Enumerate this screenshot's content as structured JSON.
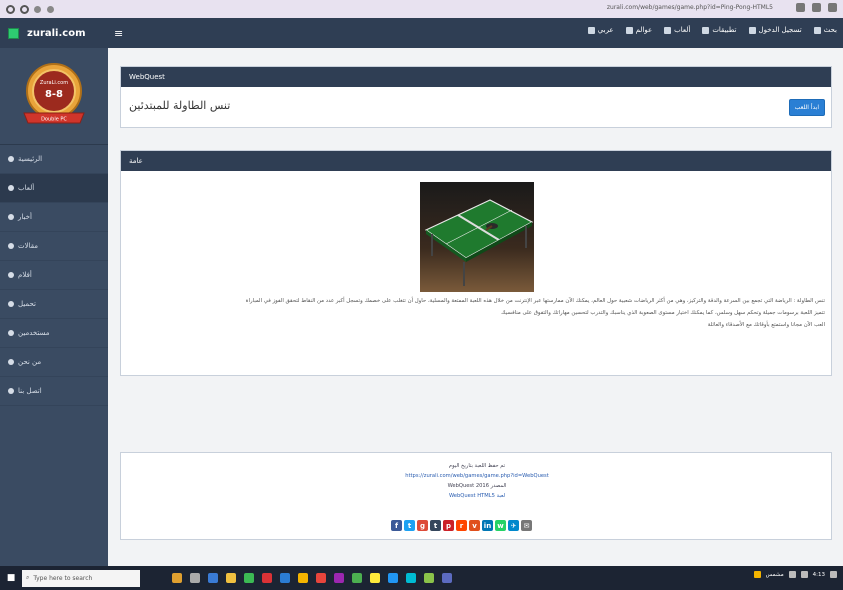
{
  "browser": {
    "url": "zurali.com/web/games/game.php?id=Ping-Pong-HTML5",
    "icons": [
      "reload-icon",
      "tab-icon",
      "back-icon",
      "forward-icon"
    ]
  },
  "navbar": {
    "brand": "zurali.com",
    "menu_icon": "≡",
    "links": [
      {
        "label": "عربي",
        "icon": "globe-icon"
      },
      {
        "label": "عوالم",
        "icon": "grid-icon"
      },
      {
        "label": "ألعاب",
        "icon": "gamepad-icon"
      },
      {
        "label": "تطبيقات",
        "icon": "apps-icon"
      },
      {
        "label": "تسجيل الدخول",
        "icon": "user-icon"
      },
      {
        "label": "بحث",
        "icon": "search-icon"
      }
    ]
  },
  "badge": {
    "line1": "ZuraLi.com",
    "score": "8-8",
    "ribbon": "Double PC"
  },
  "sidebar": {
    "items": [
      {
        "label": "الرئيسية",
        "active": false
      },
      {
        "label": "ألعاب",
        "active": true
      },
      {
        "label": "أخبار",
        "active": false
      },
      {
        "label": "مقالات",
        "active": false
      },
      {
        "label": "أفلام",
        "active": false
      },
      {
        "label": "تحميل",
        "active": false
      },
      {
        "label": "مستخدمين",
        "active": false
      },
      {
        "label": "من نحن",
        "active": false
      },
      {
        "label": "اتصل بنا",
        "active": false
      }
    ]
  },
  "title_panel": {
    "header": "WebQuest",
    "title": "تنس الطاولة للمبتدئين",
    "button": "ابدأ اللعب"
  },
  "content_panel": {
    "header": "عامة",
    "description": [
      "تنس الطاولة : الرياضة التي تجمع بين السرعة والدقة والتركيز، وهي من أكثر الرياضات شعبية حول العالم، يمكنك الآن ممارستها عبر الإنترنت من خلال هذه اللعبة الممتعة والمسلية، حاول أن تتغلب على خصمك وتسجل أكبر عدد من النقاط لتحقق الفوز في المباراة",
      "تتميز اللعبة برسومات جميلة وتحكم سهل وسلس، كما يمكنك اختيار مستوى الصعوبة الذي يناسبك والتدرب لتحسين مهاراتك والتفوق على منافسيك",
      "العب الآن مجانا واستمتع بأوقاتك مع الأصدقاء والعائلة"
    ]
  },
  "footer": {
    "lines": [
      "تم حفظ اللعبة بتاريخ اليوم",
      "https://zurali.com/web/games/game.php?id=WebQuest",
      "WebQuest 2016 المصدر",
      "WebQuest HTML5 لعبة"
    ],
    "social": [
      {
        "icon": "facebook-icon",
        "glyph": "f",
        "color": "#3b5998"
      },
      {
        "icon": "twitter-icon",
        "glyph": "t",
        "color": "#1da1f2"
      },
      {
        "icon": "google-icon",
        "glyph": "g",
        "color": "#dd4b39"
      },
      {
        "icon": "tumblr-icon",
        "glyph": "t",
        "color": "#35465c"
      },
      {
        "icon": "pinterest-icon",
        "glyph": "p",
        "color": "#cb2027"
      },
      {
        "icon": "reddit-icon",
        "glyph": "r",
        "color": "#ff4500"
      },
      {
        "icon": "vk-icon",
        "glyph": "v",
        "color": "#e04f1c"
      },
      {
        "icon": "linkedin-icon",
        "glyph": "in",
        "color": "#0077b5"
      },
      {
        "icon": "whatsapp-icon",
        "glyph": "w",
        "color": "#25d366"
      },
      {
        "icon": "telegram-icon",
        "glyph": "✈",
        "color": "#0088cc"
      },
      {
        "icon": "email-icon",
        "glyph": "✉",
        "color": "#777777"
      }
    ]
  },
  "taskbar": {
    "search_placeholder": "Type here to search",
    "tray_text": "مشمس",
    "time": "4:13"
  },
  "colors": {
    "navbar": "#2f3e54",
    "sidebar": "#3a4b62",
    "accent": "#2a7fd4"
  }
}
